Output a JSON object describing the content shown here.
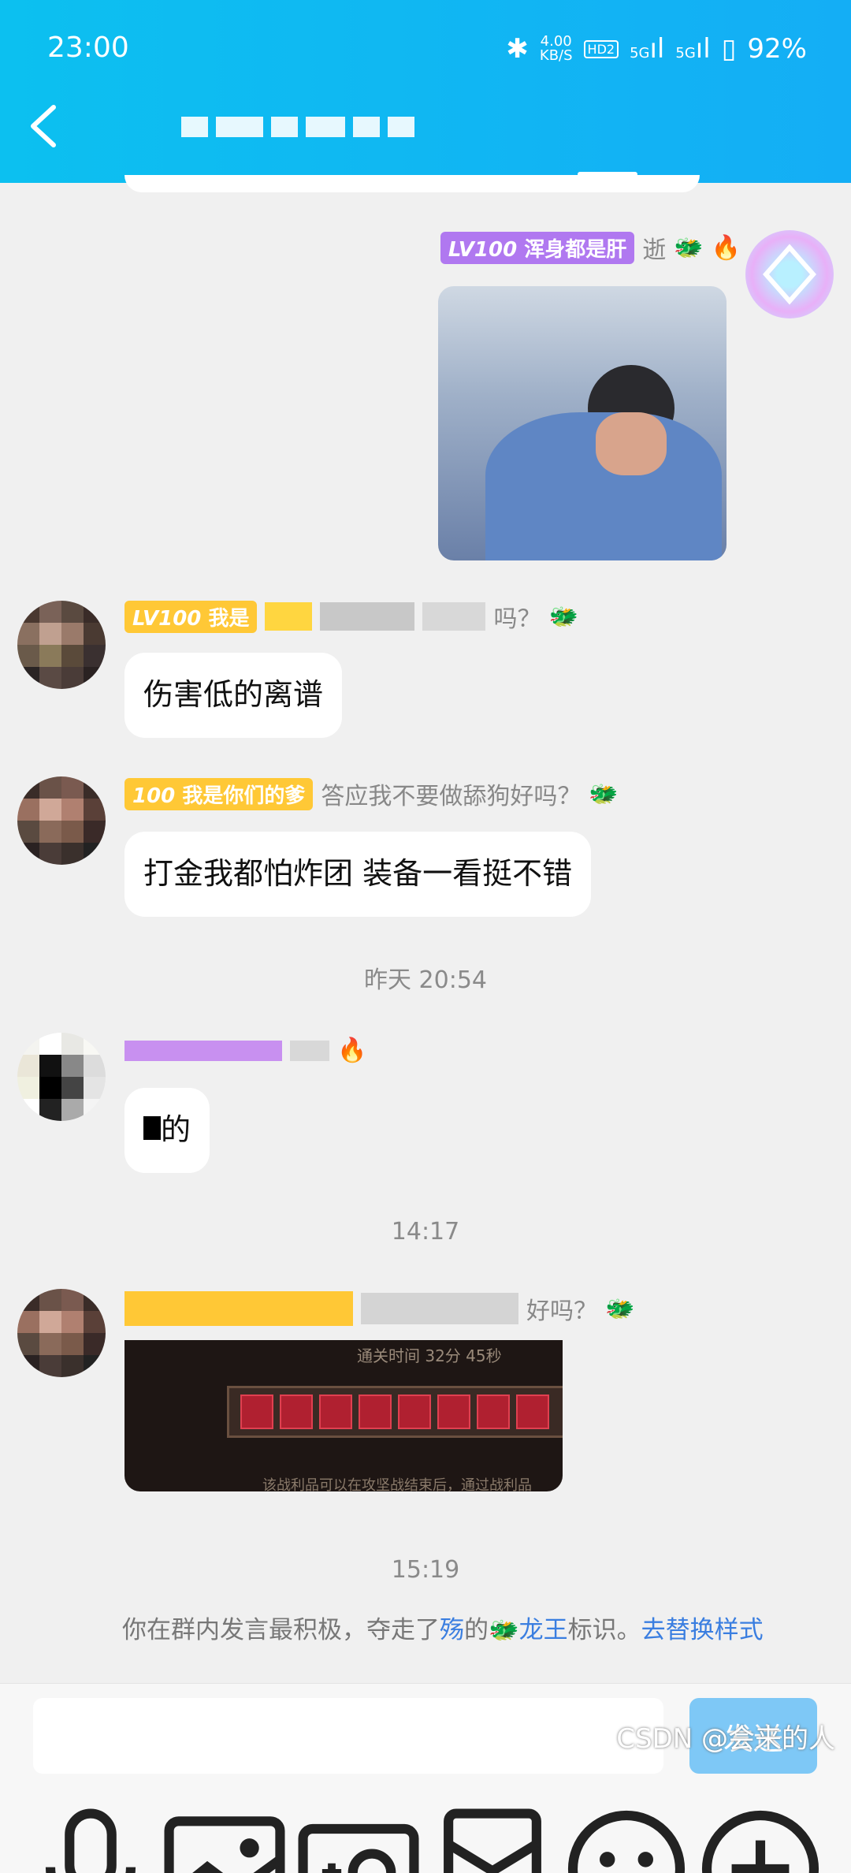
{
  "status": {
    "time": "23:00",
    "speed_top": "4.00",
    "speed_unit": "KB/S",
    "hd": "HD2",
    "net1": "5G",
    "net2": "5G",
    "battery": "92%"
  },
  "messages": {
    "me": {
      "tag": "LV100",
      "nick": "浑身都是肝",
      "suffix": "逝"
    },
    "m1": {
      "tag": "LV100",
      "nick_vis": "我是",
      "nick_tail": "吗？",
      "bubble": "伤害低的离谱"
    },
    "m2": {
      "tag": "100",
      "nick": "我是你们的爹",
      "title": "答应我不要做舔狗好吗？",
      "bubble": "打金我都怕炸团 装备一看挺不错"
    },
    "t1": "昨天 20:54",
    "m3": {
      "bubble": "的"
    },
    "t2": "14:17",
    "m4": {
      "nick_tail": "好吗？",
      "img_text": "通关时间 32分 45秒",
      "img_foot": "该战利品可以在攻坚战结束后，通过战利品"
    },
    "t3": "15:19",
    "system": {
      "p1": "你在群内发言最积极，夺走了",
      "name": "殇",
      "p2": "的",
      "badge": "龙王",
      "p3": "标识。",
      "link": "去替换样式"
    }
  },
  "bottom": {
    "send": "发送",
    "watermark": "CSDN @会来的人"
  },
  "colors": {
    "primary": "#14aef5",
    "link": "#3a7ee0",
    "send": "#7ec8f6"
  }
}
